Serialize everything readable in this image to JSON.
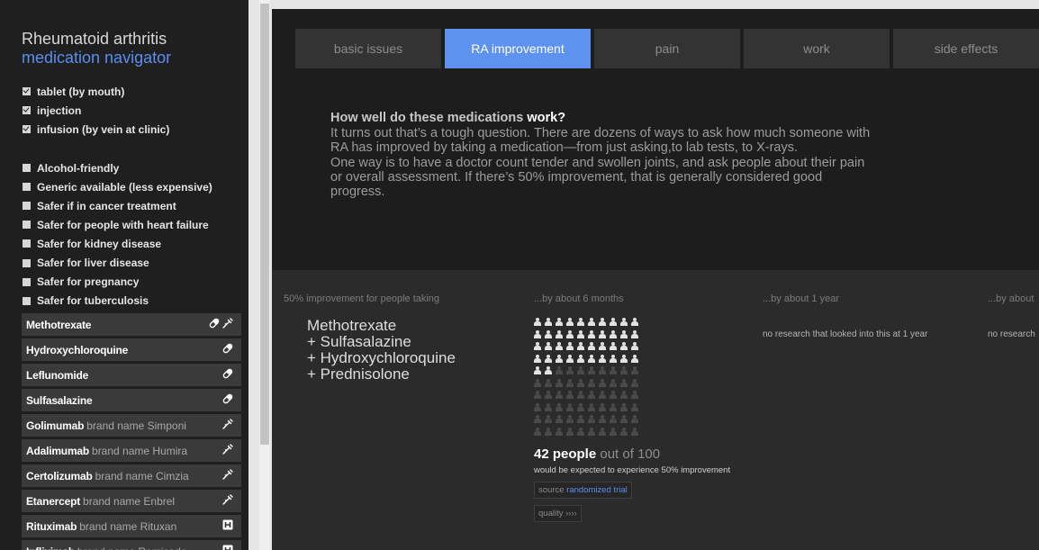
{
  "app": {
    "title_line1": "Rheumatoid arthritis",
    "title_line2": "medication navigator"
  },
  "routes": [
    {
      "label": "tablet (by mouth)",
      "checked": true
    },
    {
      "label": "injection",
      "checked": true
    },
    {
      "label": "infusion (by vein at clinic)",
      "checked": true
    }
  ],
  "properties": [
    {
      "label": "Alcohol-friendly",
      "checked": false
    },
    {
      "label": "Generic available (less expensive)",
      "checked": false
    },
    {
      "label": "Safer if in cancer treatment",
      "checked": false
    },
    {
      "label": "Safer for people with heart failure",
      "checked": false
    },
    {
      "label": "Safer for kidney disease",
      "checked": false
    },
    {
      "label": "Safer for liver disease",
      "checked": false
    },
    {
      "label": "Safer for pregnancy",
      "checked": false
    },
    {
      "label": "Safer for tuberculosis",
      "checked": false
    }
  ],
  "medications": [
    {
      "name": "Methotrexate",
      "brand": "",
      "icons": [
        "pill-icon",
        "syringe-icon"
      ]
    },
    {
      "name": "Hydroxychloroquine",
      "brand": "",
      "icons": [
        "pill-icon"
      ]
    },
    {
      "name": "Leflunomide",
      "brand": "",
      "icons": [
        "pill-icon"
      ]
    },
    {
      "name": "Sulfasalazine",
      "brand": "",
      "icons": [
        "pill-icon"
      ]
    },
    {
      "name": "Golimumab",
      "brand": "brand name Simponi",
      "icons": [
        "syringe-icon"
      ]
    },
    {
      "name": "Adalimumab",
      "brand": "brand name Humira",
      "icons": [
        "syringe-icon"
      ]
    },
    {
      "name": "Certolizumab",
      "brand": "brand name Cimzia",
      "icons": [
        "syringe-icon"
      ]
    },
    {
      "name": "Etanercept",
      "brand": "brand name Enbrel",
      "icons": [
        "syringe-icon"
      ]
    },
    {
      "name": "Rituximab",
      "brand": "brand name Rituxan",
      "icons": [
        "hospital-icon"
      ]
    },
    {
      "name": "Infliximab",
      "brand": "brand name Remicade",
      "icons": [
        "hospital-icon"
      ]
    }
  ],
  "tabs": [
    {
      "label": "basic issues",
      "active": false
    },
    {
      "label": "RA improvement",
      "active": true
    },
    {
      "label": "pain",
      "active": false
    },
    {
      "label": "work",
      "active": false
    },
    {
      "label": "side effects",
      "active": false
    }
  ],
  "intro": {
    "question_prefix": "How well do these medications ",
    "question_bold": "work?",
    "para1": "It turns out that’s a tough question. There are dozens of ways to ask how much someone with RA has improved by taking a medication—from just asking,to lab tests, to X-rays.",
    "para2": "One way is to have a doctor count tender and swollen joints, and ask people about their pain or overall assessment. If there’s 50% improvement, that is generally considered good progress."
  },
  "results": {
    "headers": [
      "50% improvement for people taking",
      "...by about 6 months",
      "...by about 1 year",
      "...by about"
    ],
    "combo": [
      "Methotrexate",
      "+ Sulfasalazine",
      "+ Hydroxychloroquine",
      "+ Prednisolone"
    ],
    "people_improved": 42,
    "people_total": 100,
    "stat_bold": "42 people",
    "stat_rest": " out of 100",
    "stat_desc": "would be expected to experience 50% improvement",
    "source_label": "source ",
    "source_link": "randomized trial",
    "quality_label": "quality ››››",
    "no_research_1yr": "no research that looked into this at 1 year",
    "no_research_next": "no research"
  }
}
